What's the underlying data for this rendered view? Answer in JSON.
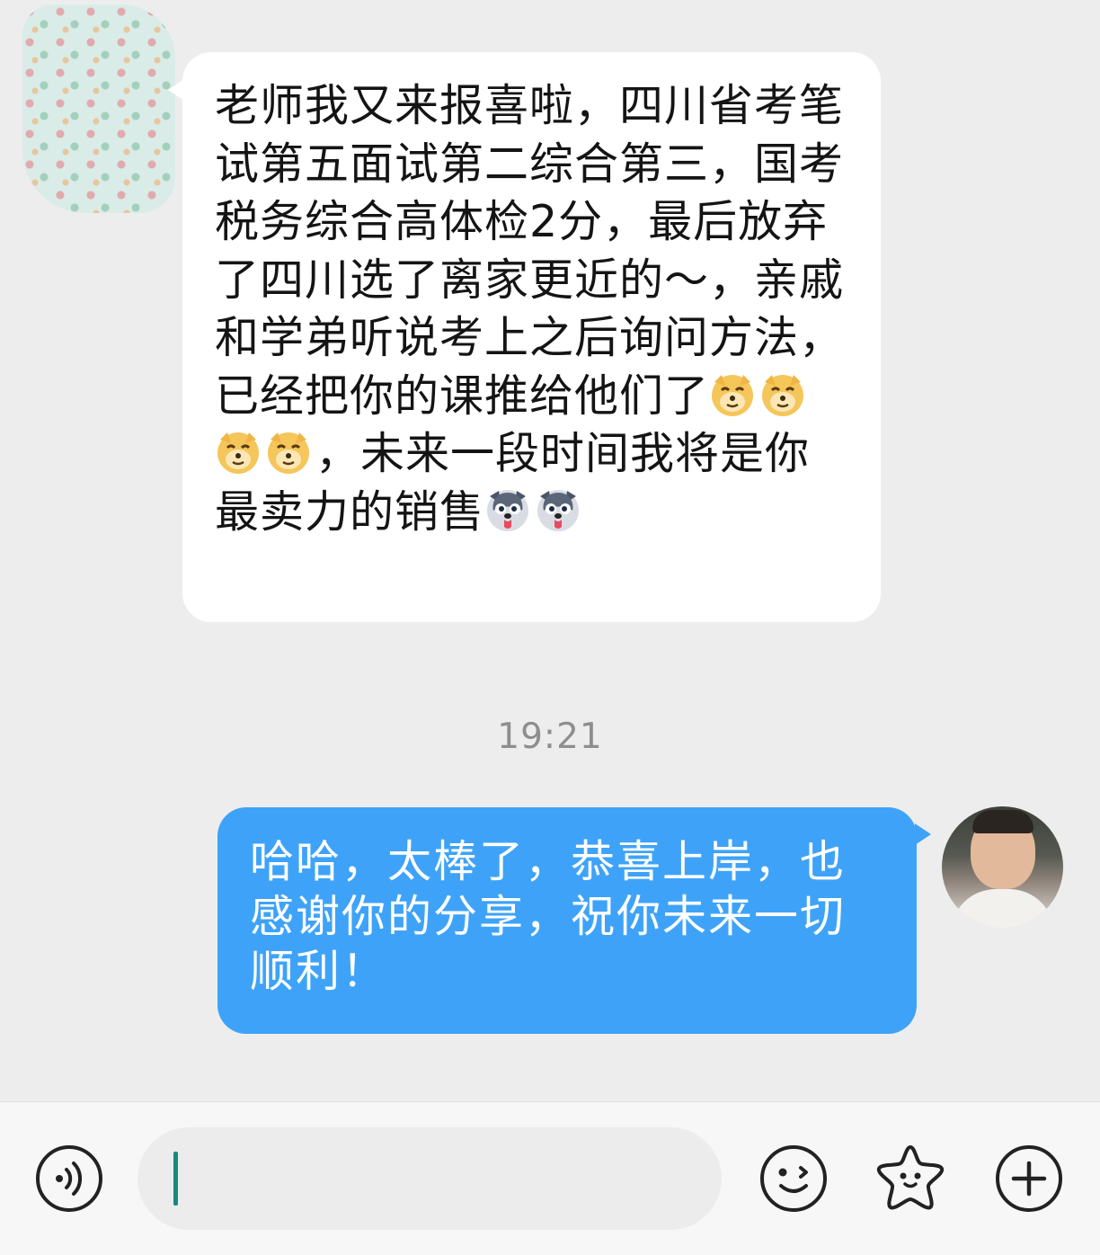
{
  "chat": {
    "incoming": {
      "text_part1": "老师我又来报喜啦，四川省考笔试第五面试第二综合第三，国考税务综合高体检2分，最后放弃了四川选了离家更近的～，亲戚和学弟听说考上之后询问方法，已经把你的课推给他们了",
      "text_part2": "，未来一段时间我将是你最卖力的销售",
      "emojis_mid": [
        "doge-icon",
        "doge-icon",
        "doge-icon",
        "doge-icon"
      ],
      "emojis_end": [
        "husky-icon",
        "husky-icon"
      ]
    },
    "timestamp": "19:21",
    "outgoing": {
      "text": "哈哈，太棒了，恭喜上岸，也感谢你的分享，祝你未来一切顺利！"
    }
  },
  "input_bar": {
    "icons": [
      "voice-icon",
      "emoji-icon",
      "favorite-icon",
      "plus-icon"
    ],
    "input_value": ""
  }
}
